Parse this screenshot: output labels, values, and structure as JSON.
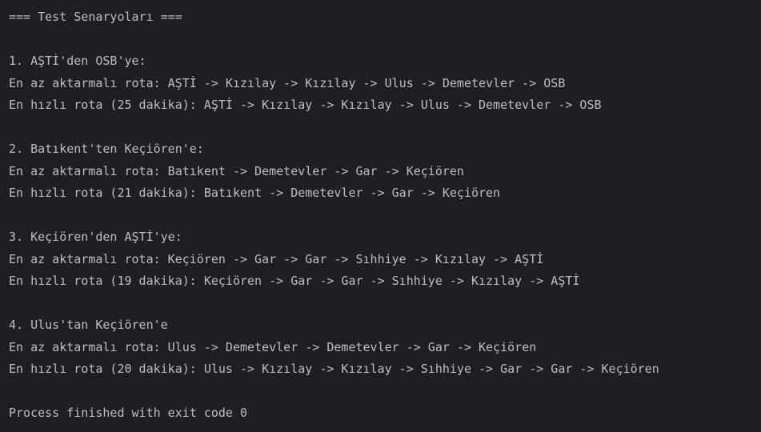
{
  "console": {
    "lines": [
      "=== Test Senaryoları ===",
      "",
      "1. AŞTİ'den OSB'ye:",
      "En az aktarmalı rota: AŞTİ -> Kızılay -> Kızılay -> Ulus -> Demetevler -> OSB",
      "En hızlı rota (25 dakika): AŞTİ -> Kızılay -> Kızılay -> Ulus -> Demetevler -> OSB",
      "",
      "2. Batıkent'ten Keçiören'e:",
      "En az aktarmalı rota: Batıkent -> Demetevler -> Gar -> Keçiören",
      "En hızlı rota (21 dakika): Batıkent -> Demetevler -> Gar -> Keçiören",
      "",
      "3. Keçiören'den AŞTİ'ye:",
      "En az aktarmalı rota: Keçiören -> Gar -> Gar -> Sıhhiye -> Kızılay -> AŞTİ",
      "En hızlı rota (19 dakika): Keçiören -> Gar -> Gar -> Sıhhiye -> Kızılay -> AŞTİ",
      "",
      "4. Ulus'tan Keçiören'e",
      "En az aktarmalı rota: Ulus -> Demetevler -> Demetevler -> Gar -> Keçiören",
      "En hızlı rota (20 dakika): Ulus -> Kızılay -> Kızılay -> Sıhhiye -> Gar -> Gar -> Keçiören",
      "",
      "Process finished with exit code 0"
    ]
  },
  "colors": {
    "background": "#1e1f22",
    "text": "#bcbec4"
  }
}
